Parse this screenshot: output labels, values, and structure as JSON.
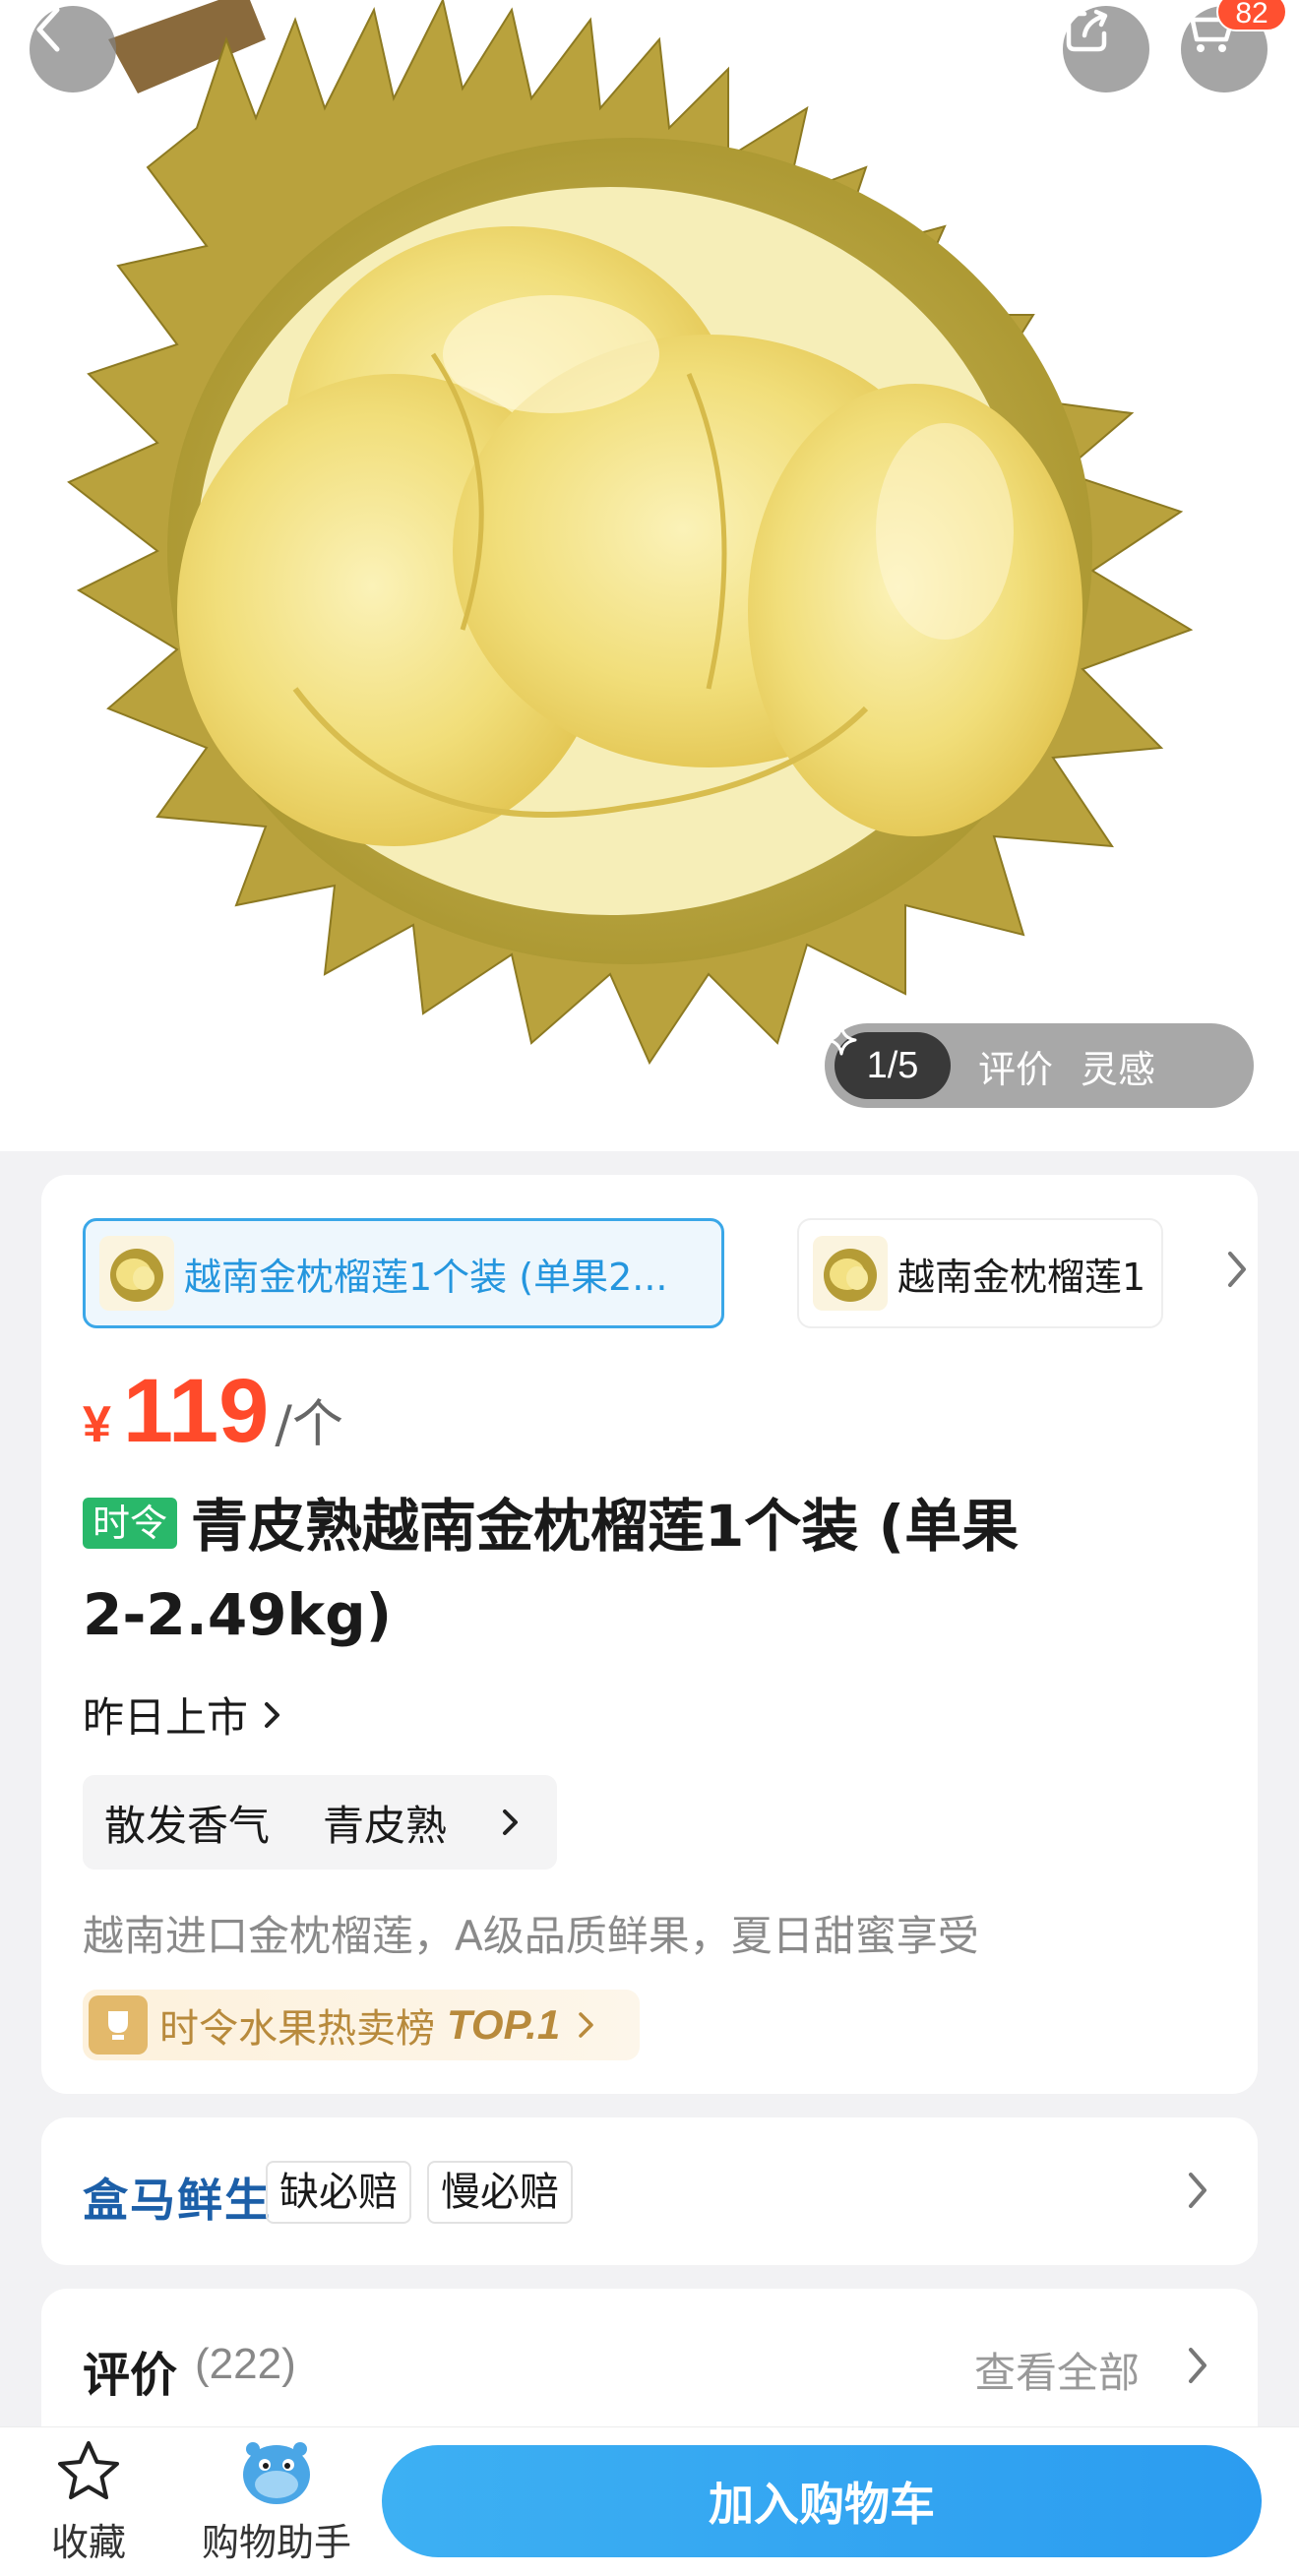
{
  "header": {
    "cart_badge": "82",
    "icons": [
      "chevron-left-icon",
      "share-icon",
      "cart-icon"
    ]
  },
  "gallery": {
    "image_description": "durian",
    "counter": "1/5",
    "reviews_label": "评价",
    "inspiration_label": "灵感"
  },
  "specs": {
    "selected_label": "越南金枕榴莲1个装 (单果2...",
    "second_label": "越南金枕榴莲1"
  },
  "price": {
    "currency": "¥",
    "value": "119",
    "unit": "/个"
  },
  "product": {
    "tag": "时令",
    "title_line1": "青皮熟越南金枕榴莲1个装 (单果",
    "title_line2": "2-2.49kg)",
    "launch_label": "昨日上市",
    "attributes": [
      "散发香气",
      "青皮熟"
    ],
    "description": "越南进口金枕榴莲，A级品质鲜果，夏日甜蜜享受",
    "rank_text": "时令水果热卖榜",
    "rank_top": "TOP.1"
  },
  "brand": {
    "name": "盒马鲜生",
    "guarantees": [
      "缺必赔",
      "慢必赔"
    ]
  },
  "reviews": {
    "title": "评价",
    "count": "(222)",
    "view_all": "查看全部"
  },
  "bottom_bar": {
    "favorite_label": "收藏",
    "assistant_label": "购物助手",
    "add_to_cart": "加入购物车"
  },
  "colors": {
    "accent_blue": "#2b9cf0",
    "price_red": "#ff4a2a",
    "season_green": "#29b86a"
  }
}
